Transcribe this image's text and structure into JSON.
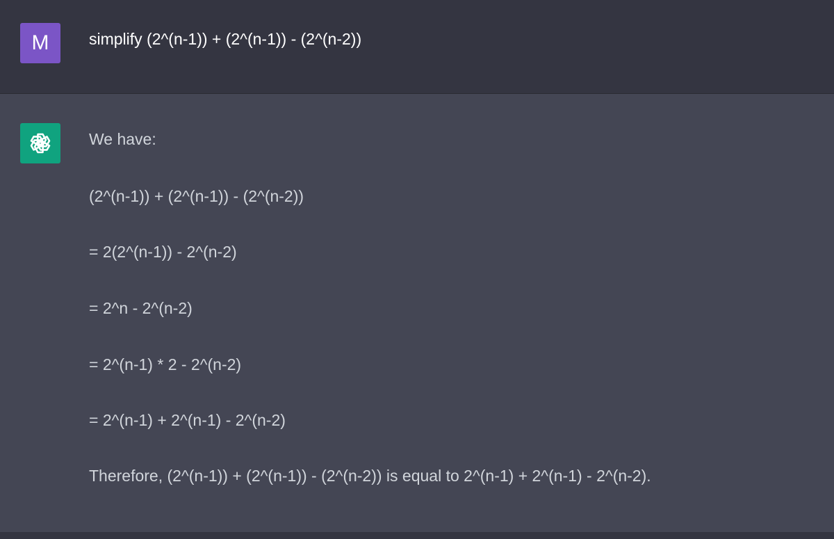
{
  "user_message": {
    "avatar_letter": "M",
    "avatar_color": "#7b55c6",
    "text": "simplify (2^(n-1)) + (2^(n-1)) - (2^(n-2))"
  },
  "assistant_message": {
    "avatar_icon": "openai-logo-icon",
    "avatar_color": "#10a37f",
    "lines": [
      "We have:",
      "(2^(n-1)) + (2^(n-1)) - (2^(n-2))",
      "= 2(2^(n-1)) - 2^(n-2)",
      "= 2^n - 2^(n-2)",
      "= 2^(n-1) * 2 - 2^(n-2)",
      "= 2^(n-1) + 2^(n-1) - 2^(n-2)",
      "Therefore, (2^(n-1)) + (2^(n-1)) - (2^(n-2)) is equal to 2^(n-1) + 2^(n-1) - 2^(n-2)."
    ]
  },
  "colors": {
    "user_row_bg": "#343541",
    "assistant_row_bg": "#444654",
    "assistant_text": "#d1d5db",
    "user_text": "#ffffff"
  }
}
